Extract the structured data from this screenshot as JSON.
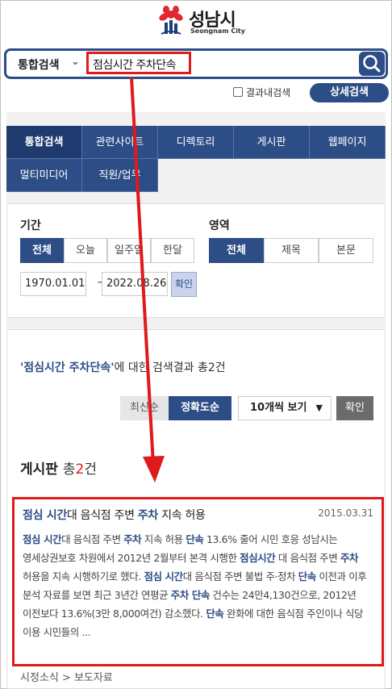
{
  "header": {
    "city_name": "성남시",
    "city_name_en": "Seongnam City"
  },
  "search": {
    "scope_label": "통합검색",
    "query": "점심시간 주차단속"
  },
  "options": {
    "within_results_label": "결과내검색",
    "within_results_checked": false,
    "advanced_search_label": "상세검색"
  },
  "tabs": [
    {
      "label": "통합검색",
      "active": true
    },
    {
      "label": "관련사이트",
      "active": false
    },
    {
      "label": "디렉토리",
      "active": false
    },
    {
      "label": "게시판",
      "active": false
    },
    {
      "label": "웹페이지",
      "active": false
    },
    {
      "label": "멀티미디어",
      "active": false
    },
    {
      "label": "직원/업무",
      "active": false
    }
  ],
  "filters": {
    "period_title": "기간",
    "period_options": [
      {
        "label": "전체",
        "selected": true
      },
      {
        "label": "오늘",
        "selected": false
      },
      {
        "label": "일주일",
        "selected": false
      },
      {
        "label": "한달",
        "selected": false
      }
    ],
    "date_from": "1970.01.01",
    "date_separator": "~",
    "date_to": "2022.08.26",
    "confirm_label": "확인",
    "area_title": "영역",
    "area_options": [
      {
        "label": "전체",
        "selected": true
      },
      {
        "label": "제목",
        "selected": false
      },
      {
        "label": "본문",
        "selected": false
      }
    ]
  },
  "results": {
    "summary_query": "'점심시간 주차단속'",
    "summary_text": "에 대한 검색결과",
    "summary_total": "총2건",
    "sort_options": [
      {
        "label": "최신순",
        "selected": false
      },
      {
        "label": "정확도순",
        "selected": true
      }
    ],
    "per_page_label": "10개씩 보기",
    "confirm_label": "확인",
    "section_name": "게시판",
    "section_total_prefix": "총",
    "section_total_count": "2",
    "section_total_suffix": "건",
    "items": [
      {
        "title_kw1": "점심 시간",
        "title_mid": "대 음식점 주변 ",
        "title_kw2": "주차",
        "title_end": " 지속 허용",
        "date": "2015.03.31",
        "body": [
          {
            "t": "점심 시간",
            "kw": true
          },
          {
            "t": "대 음식점 주변 ",
            "kw": false
          },
          {
            "t": "주차",
            "kw": true
          },
          {
            "t": " 지속 허용 ",
            "kw": false
          },
          {
            "t": "단속",
            "kw": true
          },
          {
            "t": " 13.6% 줄어 시민 호응 성남시는 영세상권보호 차원에서 2012년 2월부터 본격 시행한 ",
            "kw": false
          },
          {
            "t": "점심시간",
            "kw": true
          },
          {
            "t": " 대 음식점 주변 ",
            "kw": false
          },
          {
            "t": "주차",
            "kw": true
          },
          {
            "t": " 허용을 지속 시행하기로 했다. ",
            "kw": false
          },
          {
            "t": "점심 시간",
            "kw": true
          },
          {
            "t": "대 음식점 주변 불법 주·정차 ",
            "kw": false
          },
          {
            "t": "단속",
            "kw": true
          },
          {
            "t": " 이전과 이후 분석 자료를 보면 최근 3년간 연평균 ",
            "kw": false
          },
          {
            "t": "주차 단속",
            "kw": true
          },
          {
            "t": " 건수는 24만4,130건으로, 2012년 이전보다 13.6%(3만 8,000여건) 감소했다. ",
            "kw": false
          },
          {
            "t": "단속",
            "kw": true
          },
          {
            "t": " 완화에 대한 음식점 주인이나 식당 이용 시민들의 ...",
            "kw": false
          }
        ],
        "path": "시정소식 > 보도자료"
      }
    ]
  },
  "colors": {
    "primary": "#2d4d86",
    "highlight_red": "#e0191b",
    "panel_bg": "#f1f1f1"
  }
}
